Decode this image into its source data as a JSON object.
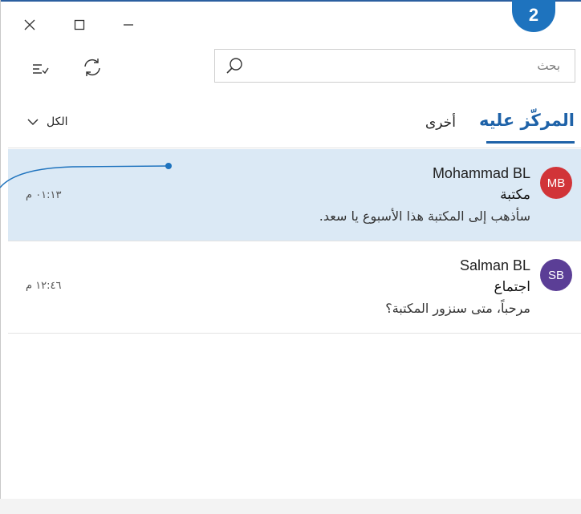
{
  "window": {
    "badge_number": "2",
    "accent_color": "#1e62a8"
  },
  "toolbar": {
    "filter_icon": "select-all-icon",
    "sync_icon": "sync-icon",
    "search_placeholder": "بحث"
  },
  "tabs": {
    "focused_label": "المركّز عليه",
    "other_label": "أخرى",
    "filter_label": "الكل"
  },
  "messages": [
    {
      "initials": "MB",
      "avatar_color": "#d13438",
      "sender": "Mohammad BL",
      "subject": "مكتبة",
      "preview": "سأذهب إلى المكتبة هذا الأسبوع يا سعد.",
      "time": "٠١:١٣ م",
      "selected": true
    },
    {
      "initials": "SB",
      "avatar_color": "#5b3e96",
      "sender": "Salman BL",
      "subject": "اجتماع",
      "preview": "مرحباً، متى سنزور المكتبة؟",
      "time": "١٢:٤٦ م",
      "selected": false
    }
  ]
}
